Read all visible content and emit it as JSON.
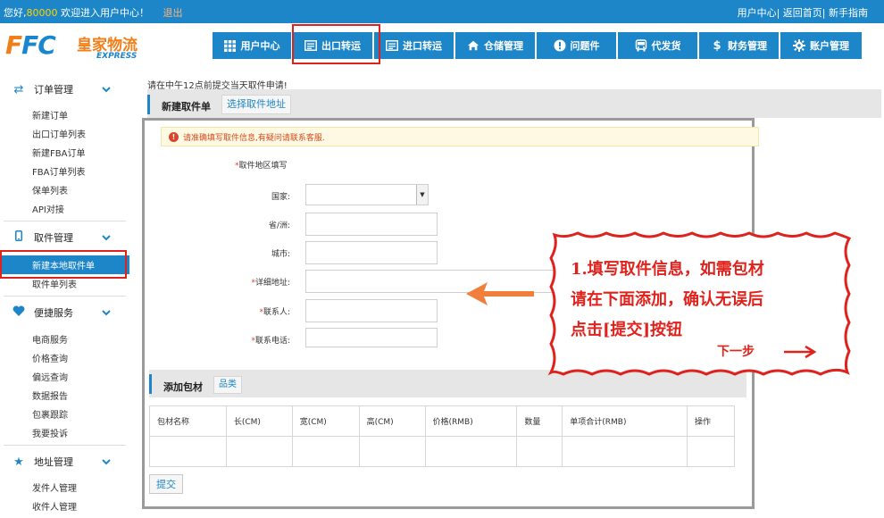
{
  "topbar": {
    "greeting_prefix": "您好,",
    "user_id": "80000",
    "greeting_suffix": "欢迎进入用户中心！",
    "logout": "退出",
    "links": "用户中心| 返回首页| 新手指南"
  },
  "logo": {
    "brand_letters_1": "F",
    "brand_letters_2": "FC",
    "brand_cn": "皇家物流",
    "brand_en": "EXPRESS"
  },
  "nav": {
    "items": [
      {
        "label": "用户中心",
        "icon": "grid-icon"
      },
      {
        "label": "出口转运",
        "icon": "list-card-icon"
      },
      {
        "label": "进口转运",
        "icon": "list-card-icon"
      },
      {
        "label": "仓储管理",
        "icon": "house-icon"
      },
      {
        "label": "问题件",
        "icon": "alert-icon"
      },
      {
        "label": "代发货",
        "icon": "bus-icon"
      },
      {
        "label": "财务管理",
        "icon": "dollar-icon"
      },
      {
        "label": "账户管理",
        "icon": "gear-icon"
      }
    ]
  },
  "sidebar": {
    "groups": [
      {
        "title": "订单管理",
        "icon": "transfer-icon",
        "items": [
          "新建订单",
          "出口订单列表",
          "新建FBA订单",
          "FBA订单列表",
          "保单列表",
          "API对接"
        ]
      },
      {
        "title": "取件管理",
        "icon": "phone-icon",
        "items": [
          "新建本地取件单",
          "取件单列表"
        ]
      },
      {
        "title": "便捷服务",
        "icon": "heart-icon",
        "items": [
          "电商服务",
          "价格查询",
          "偏远查询",
          "数据报告",
          "包裹跟踪",
          "我要投诉"
        ]
      },
      {
        "title": "地址管理",
        "icon": "star-icon",
        "items": [
          "发件人管理",
          "收件人管理"
        ]
      }
    ],
    "active_item": "新建本地取件单"
  },
  "main": {
    "notice": "请在中午12点前提交当天取件申请!",
    "title": "新建取件单",
    "select_address_btn": "选择取件地址",
    "warning": "请准确填写取件信息,有疑问请联系客服.",
    "section_label": "取件地区填写",
    "fields": {
      "country_label": "国家:",
      "province_label": "省/洲:",
      "city_label": "城市:",
      "address_label": "详细地址:",
      "contact_label": "联系人:",
      "phone_label": "联系电话:"
    },
    "package": {
      "title": "添加包材",
      "category_btn": "品类",
      "columns": [
        "包材名称",
        "长(CM)",
        "宽(CM)",
        "高(CM)",
        "价格(RMB)",
        "数量",
        "单项合计(RMB)",
        "操作"
      ]
    },
    "submit": "提交"
  },
  "callout": {
    "line1": "1.填写取件信息，如需包材",
    "line2": "请在下面添加，确认无误后",
    "line3": "点击[提交]按钮",
    "next": "下一步"
  },
  "colors": {
    "primary": "#1d86c8",
    "highlight": "#e0221c",
    "arrow": "#f07f3c",
    "brand_orange": "#f07f1a"
  }
}
